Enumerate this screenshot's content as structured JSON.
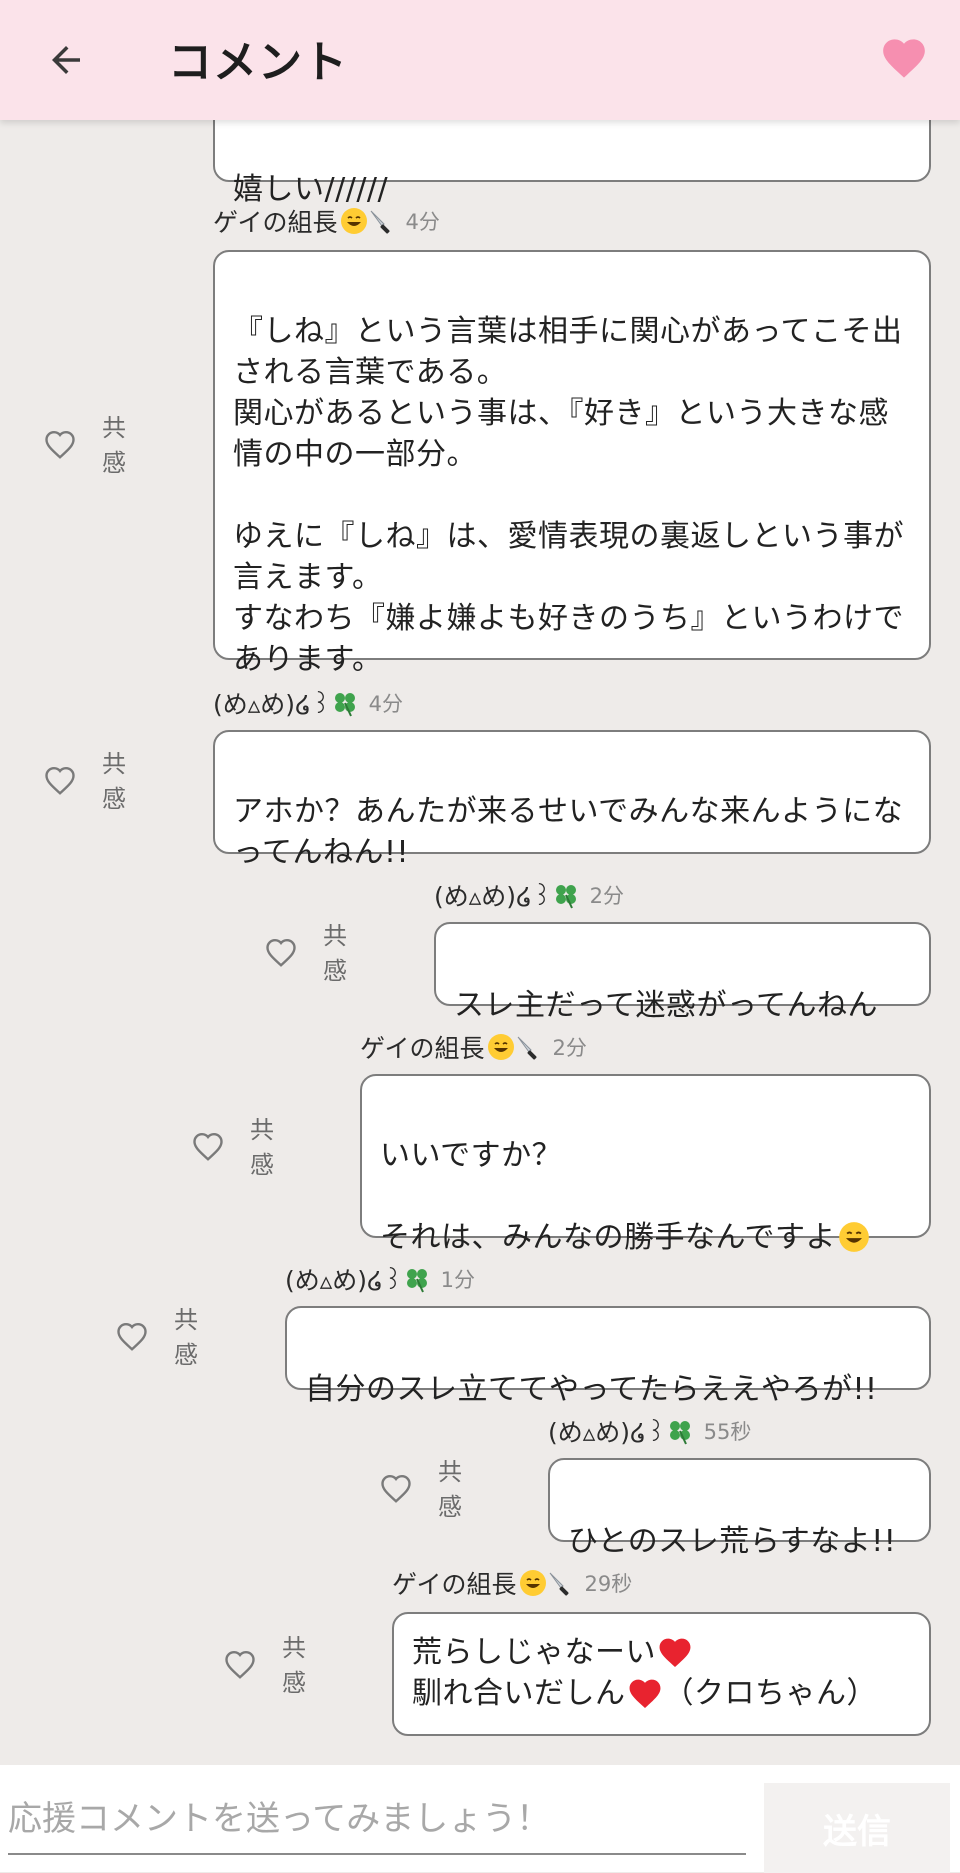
{
  "header": {
    "title": "コメント",
    "back_icon": "arrow-left-icon",
    "favorite_icon": "heart-icon",
    "accent_color": "#f68fb0",
    "background_color": "#fbe3ea"
  },
  "like_label": "共感",
  "comments": [
    {
      "user": "",
      "time": "",
      "text": "嬉しい//////"
    },
    {
      "user": "ゲイの組長",
      "user_emoji": "grinning-face, knife",
      "time": "4分",
      "text": "『しね』という言葉は相手に関心があってこそ出される言葉である。\n関心があるという事は、『好き』という大きな感情の中の一部分。\n\nゆえに『しね』は、愛情表現の裏返しという事が言えます。\nすなわち『嫌よ嫌よも好きのうち』というわけであります。"
    },
    {
      "user": "(め▵め)໒꒱",
      "user_emoji": "four-leaf-clover",
      "time": "4分",
      "text": "アホか？あんたが来るせいでみんな来んようになってんねん!!"
    },
    {
      "user": "(め▵め)໒꒱",
      "user_emoji": "four-leaf-clover",
      "time": "2分",
      "text": "スレ主だって迷惑がってんねん"
    },
    {
      "user": "ゲイの組長",
      "user_emoji": "grinning-face, knife",
      "time": "2分",
      "text": "いいですか？\n\nそれは、みんなの勝手なんですよ"
    },
    {
      "user": "(め▵め)໒꒱",
      "user_emoji": "four-leaf-clover",
      "time": "1分",
      "text": "自分のスレ立ててやってたらええやろが!!"
    },
    {
      "user": "(め▵め)໒꒱",
      "user_emoji": "four-leaf-clover",
      "time": "55秒",
      "text": "ひとのスレ荒らすなよ!!"
    },
    {
      "user": "ゲイの組長",
      "user_emoji": "grinning-face, knife",
      "time": "29秒",
      "text_line1": "荒らしじゃなーい",
      "text_line2a": "馴れ合いだしん",
      "text_line2b": "（クロちゃん）",
      "text_emoji": "red-heart"
    }
  ],
  "footer": {
    "placeholder": "応援コメントを送ってみましょう！",
    "send_label": "送信"
  }
}
